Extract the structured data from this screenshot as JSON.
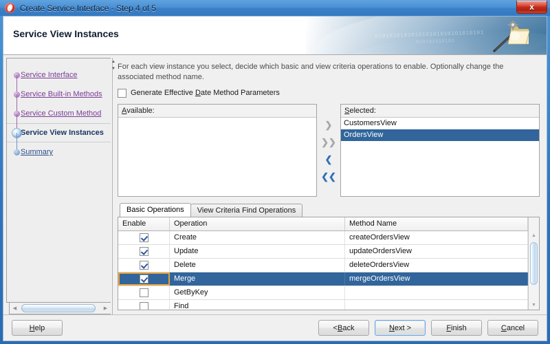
{
  "window": {
    "title": "Create Service Interface - Step 4 of 5",
    "app_icon": "oracle-jdeveloper-icon",
    "close_label": "x"
  },
  "banner": {
    "heading": "Service View Instances",
    "binary_decoration_1": "010101010101010101010101010101",
    "binary_decoration_2": "010101010101",
    "icon": "folder-wand-gear-icon"
  },
  "sidebar": {
    "steps": [
      {
        "label": "Service Interface",
        "state": "visited"
      },
      {
        "label": "Service Built-in Methods",
        "state": "visited"
      },
      {
        "label": "Service Custom Method",
        "state": "visited"
      },
      {
        "label": "Service View Instances",
        "state": "current"
      },
      {
        "label": "Summary",
        "state": "future"
      }
    ]
  },
  "main": {
    "description": "For each view instance you select, decide which basic and view criteria operations to enable. Optionally change the associated method name.",
    "generate_checkbox": {
      "label_before": "Generate Effective ",
      "label_mnemonic": "D",
      "label_after": "ate Method Parameters",
      "checked": false
    },
    "available": {
      "label_mnemonic": "A",
      "label_after": "vailable:",
      "items": []
    },
    "selected": {
      "label_mnemonic": "S",
      "label_after": "elected:",
      "items": [
        {
          "label": "CustomersView",
          "selected": false
        },
        {
          "label": "OrdersView",
          "selected": true
        }
      ]
    },
    "transfer_buttons": [
      {
        "name": "move-right-button",
        "glyph": "❯",
        "enabled": false
      },
      {
        "name": "move-all-right-button",
        "glyph": "❯❯",
        "enabled": false
      },
      {
        "name": "move-left-button",
        "glyph": "❮",
        "enabled": true
      },
      {
        "name": "move-all-left-button",
        "glyph": "❮❮",
        "enabled": true
      }
    ],
    "tabs": [
      {
        "label": "Basic Operations",
        "active": true
      },
      {
        "label": "View Criteria Find Operations",
        "active": false
      }
    ],
    "table": {
      "columns": [
        "Enable",
        "Operation",
        "Method Name"
      ],
      "rows": [
        {
          "enabled": true,
          "operation": "Create",
          "method": "createOrdersView",
          "selected": false,
          "focused": false
        },
        {
          "enabled": true,
          "operation": "Update",
          "method": "updateOrdersView",
          "selected": false,
          "focused": false
        },
        {
          "enabled": true,
          "operation": "Delete",
          "method": "deleteOrdersView",
          "selected": false,
          "focused": false
        },
        {
          "enabled": true,
          "operation": "Merge",
          "method": "mergeOrdersView",
          "selected": true,
          "focused": true
        },
        {
          "enabled": false,
          "operation": "GetByKey",
          "method": "",
          "selected": false,
          "focused": false
        },
        {
          "enabled": false,
          "operation": "Find",
          "method": "",
          "selected": false,
          "focused": false
        }
      ]
    }
  },
  "footer": {
    "help": {
      "mnemonic": "H",
      "after": "elp"
    },
    "back": {
      "before": "< ",
      "mnemonic": "B",
      "after": "ack"
    },
    "next": {
      "mnemonic": "N",
      "after": "ext >",
      "focused": true
    },
    "finish": {
      "mnemonic": "F",
      "after": "inish"
    },
    "cancel": {
      "mnemonic": "C",
      "after": "ancel"
    }
  },
  "colors": {
    "selection_blue": "#31659b",
    "focus_gold": "#e8a33d",
    "link_purple": "#7a3e96",
    "link_blue": "#2b4f87",
    "title_bar_blue": "#4a90d4"
  }
}
